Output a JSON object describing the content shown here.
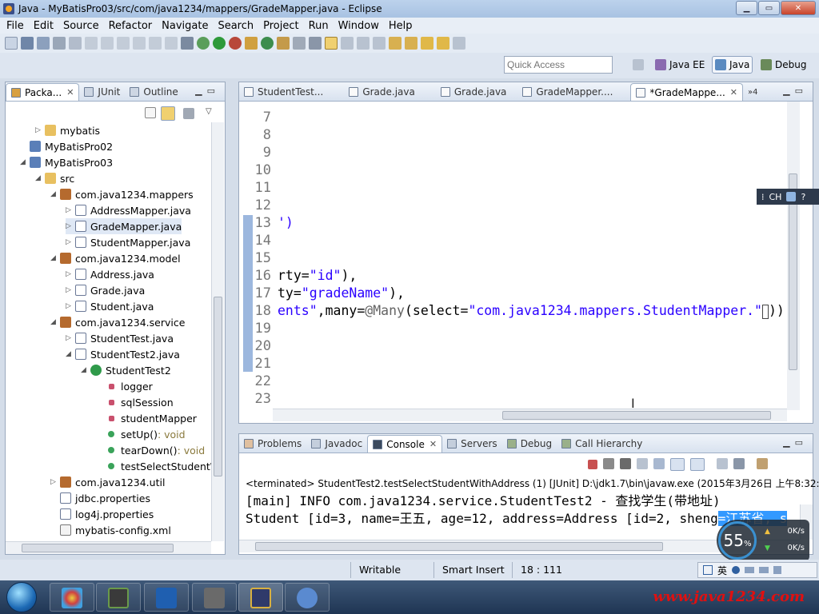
{
  "window": {
    "title": "Java - MyBatisPro03/src/com/java1234/mappers/GradeMapper.java - Eclipse",
    "controls": {
      "minimize": "▁",
      "maximize": "▭",
      "close": "✕"
    }
  },
  "menu": [
    "File",
    "Edit",
    "Source",
    "Refactor",
    "Navigate",
    "Search",
    "Project",
    "Run",
    "Window",
    "Help"
  ],
  "quick_access": {
    "placeholder": "Quick Access"
  },
  "perspectives": [
    "Java EE",
    "Java",
    "Debug"
  ],
  "left_panel": {
    "tabs": [
      "Packa...",
      "JUnit",
      "Outline"
    ],
    "tree": [
      {
        "label": "mybatis",
        "type": "folder",
        "depth": 1,
        "arrow": "▷"
      },
      {
        "label": "MyBatisPro02",
        "type": "project",
        "depth": 0,
        "arrow": ""
      },
      {
        "label": "MyBatisPro03",
        "type": "project",
        "depth": 0,
        "arrow": "◢"
      },
      {
        "label": "src",
        "type": "folder",
        "depth": 1,
        "arrow": "◢"
      },
      {
        "label": "com.java1234.mappers",
        "type": "pkg",
        "depth": 2,
        "arrow": "◢"
      },
      {
        "label": "AddressMapper.java",
        "type": "jfile",
        "depth": 3,
        "arrow": "▷"
      },
      {
        "label": "GradeMapper.java",
        "type": "jfile",
        "depth": 3,
        "arrow": "▷"
      },
      {
        "label": "StudentMapper.java",
        "type": "jfile",
        "depth": 3,
        "arrow": "▷"
      },
      {
        "label": "com.java1234.model",
        "type": "pkg",
        "depth": 2,
        "arrow": "◢"
      },
      {
        "label": "Address.java",
        "type": "jfile",
        "depth": 3,
        "arrow": "▷"
      },
      {
        "label": "Grade.java",
        "type": "jfile",
        "depth": 3,
        "arrow": "▷"
      },
      {
        "label": "Student.java",
        "type": "jfile",
        "depth": 3,
        "arrow": "▷"
      },
      {
        "label": "com.java1234.service",
        "type": "pkg",
        "depth": 2,
        "arrow": "◢"
      },
      {
        "label": "StudentTest.java",
        "type": "jfile",
        "depth": 3,
        "arrow": "▷"
      },
      {
        "label": "StudentTest2.java",
        "type": "jfile",
        "depth": 3,
        "arrow": "◢"
      },
      {
        "label": "StudentTest2",
        "type": "class",
        "depth": 4,
        "arrow": "◢"
      },
      {
        "label": "logger",
        "type": "field",
        "depth": 5,
        "arrow": ""
      },
      {
        "label": "sqlSession",
        "type": "field",
        "depth": 5,
        "arrow": ""
      },
      {
        "label": "studentMapper",
        "type": "field",
        "depth": 5,
        "arrow": ""
      },
      {
        "label": "setUp()",
        "ret": " : void",
        "type": "method",
        "depth": 5,
        "arrow": ""
      },
      {
        "label": "tearDown()",
        "ret": " : void",
        "type": "method",
        "depth": 5,
        "arrow": ""
      },
      {
        "label": "testSelectStudentW",
        "type": "method",
        "depth": 5,
        "arrow": ""
      },
      {
        "label": "com.java1234.util",
        "type": "pkg",
        "depth": 2,
        "arrow": "▷"
      },
      {
        "label": "jdbc.properties",
        "type": "jfile",
        "depth": 2,
        "arrow": ""
      },
      {
        "label": "log4j.properties",
        "type": "jfile",
        "depth": 2,
        "arrow": ""
      },
      {
        "label": "mybatis-config.xml",
        "type": "xml",
        "depth": 2,
        "arrow": ""
      }
    ]
  },
  "editor": {
    "tabs": [
      "StudentTest...",
      "Grade.java",
      "Grade.java",
      "GradeMapper....",
      "*GradeMappe..."
    ],
    "overflow": "»4",
    "line_numbers": [
      "7",
      "8",
      "9",
      "10",
      "11",
      "12",
      "13",
      "14",
      "15",
      "16",
      "17",
      "18",
      "19",
      "20",
      "21",
      "22",
      "23"
    ],
    "code": {
      "l13": "')",
      "l16_a": "rty=",
      "l16_b": "\"id\"",
      "l16_c": "),",
      "l17_a": "ty=",
      "l17_b": "\"gradeName\"",
      "l17_c": "),",
      "l18_a": "ents\"",
      "l18_b": ",many=",
      "l18_c": "@Many",
      "l18_d": "(select=",
      "l18_e": "\"com.java1234.mappers.StudentMapper.\"",
      "l18_f": "))"
    }
  },
  "ime": {
    "lang": "CH"
  },
  "console": {
    "tabs": [
      "Problems",
      "Javadoc",
      "Console",
      "Servers",
      "Debug",
      "Call Hierarchy"
    ],
    "terminated": "<terminated> StudentTest2.testSelectStudentWithAddress (1) [JUnit] D:\\jdk1.7\\bin\\javaw.exe (2015年3月26日 上午8:32:13)",
    "line1": "[main] INFO com.java1234.service.StudentTest2 - 查找学生(带地址)",
    "line2_a": "Student [id=3, name=王五, age=12, address=Address [id=2, sheng",
    "line2_b": "=江苏省, s"
  },
  "net_widget": {
    "percent": "55",
    "unit": "%",
    "up": "0K/s",
    "down": "0K/s"
  },
  "status": {
    "mode": "Writable",
    "insert": "Smart Insert",
    "position": "18 : 111"
  },
  "tray": {
    "ime": "英"
  },
  "watermark": "www.java1234.com"
}
